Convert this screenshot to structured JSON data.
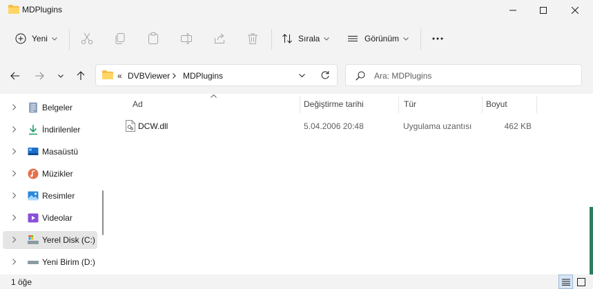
{
  "window": {
    "title": "MDPlugins"
  },
  "toolbar": {
    "new_label": "Yeni",
    "sort_label": "Sırala",
    "view_label": "Görünüm"
  },
  "address": {
    "overflow": "«",
    "crumbs": [
      "DVBViewer",
      "MDPlugins"
    ]
  },
  "search": {
    "placeholder": "Ara: MDPlugins"
  },
  "nav": {
    "items": [
      {
        "label": "Belgeler",
        "icon": "documents-icon"
      },
      {
        "label": "İndirilenler",
        "icon": "downloads-icon"
      },
      {
        "label": "Masaüstü",
        "icon": "desktop-icon"
      },
      {
        "label": "Müzikler",
        "icon": "music-icon"
      },
      {
        "label": "Resimler",
        "icon": "pictures-icon"
      },
      {
        "label": "Videolar",
        "icon": "videos-icon"
      },
      {
        "label": "Yerel Disk (C:)",
        "icon": "local-disk-icon"
      },
      {
        "label": "Yeni Birim (D:)",
        "icon": "drive-icon"
      }
    ],
    "selected_index": 6
  },
  "columns": {
    "name": "Ad",
    "modified": "Değiştirme tarihi",
    "type": "Tür",
    "size": "Boyut"
  },
  "files": [
    {
      "name": "DCW.dll",
      "modified": "5.04.2006 20:48",
      "type": "Uygulama uzantısı",
      "size": "462 KB"
    }
  ],
  "status": {
    "count": "1 öğe"
  },
  "colors": {
    "accent": "#0067c0",
    "folder": "#f4c04a",
    "selected_bg": "#e5e5e5"
  }
}
